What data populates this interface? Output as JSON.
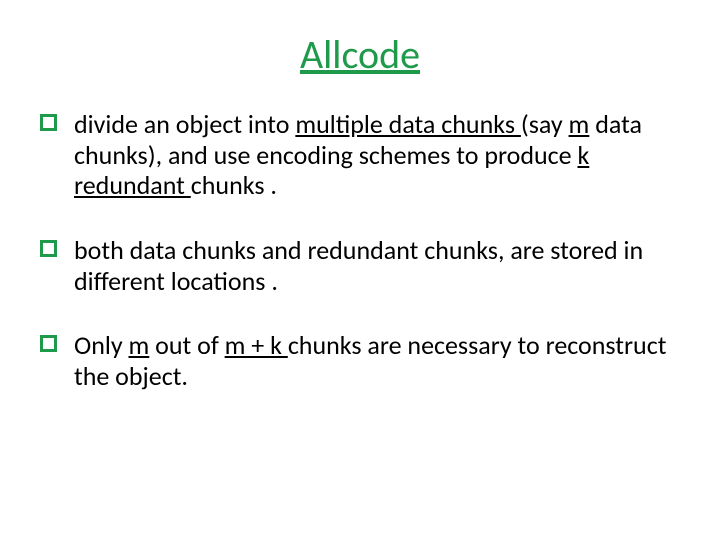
{
  "title_color": "#1F9A4B",
  "bullet_color": "#1F9A4B",
  "title": "Allcode",
  "bullets": [
    {
      "segments": [
        {
          "t": "divide an object into "
        },
        {
          "t": "multiple data chunks ",
          "u": true
        },
        {
          "t": " (say "
        },
        {
          "t": "m",
          "u": true
        },
        {
          "t": " data chunks), and use encoding schemes to produce  "
        },
        {
          "t": "k redundant ",
          "u": true
        },
        {
          "t": "chunks ."
        }
      ]
    },
    {
      "segments": [
        {
          "t": " both data chunks and redundant chunks, are stored  in different locations ."
        }
      ]
    },
    {
      "segments": [
        {
          "t": " Only "
        },
        {
          "t": "m",
          "u": true
        },
        {
          "t": " out of "
        },
        {
          "t": "m + k ",
          "u": true
        },
        {
          "t": "chunks are necessary to reconstruct the object."
        }
      ]
    }
  ]
}
